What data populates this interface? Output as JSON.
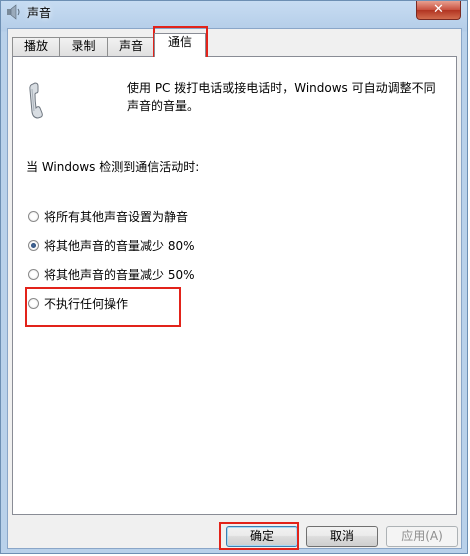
{
  "window": {
    "title": "声音",
    "close_label": "✕"
  },
  "tabs": [
    {
      "label": "播放",
      "active": false
    },
    {
      "label": "录制",
      "active": false
    },
    {
      "label": "声音",
      "active": false
    },
    {
      "label": "通信",
      "active": true
    }
  ],
  "panel": {
    "description": "使用 PC 拨打电话或接电话时，Windows 可自动调整不同声音的音量。",
    "section_label": "当 Windows 检测到通信活动时:",
    "options": [
      {
        "label": "将所有其他声音设置为静音",
        "checked": false
      },
      {
        "label": "将其他声音的音量减少 80%",
        "checked": true
      },
      {
        "label": "将其他声音的音量减少 50%",
        "checked": false
      },
      {
        "label": "不执行任何操作",
        "checked": false
      }
    ]
  },
  "buttons": {
    "ok": "确定",
    "cancel": "取消",
    "apply": "应用(A)"
  },
  "colors": {
    "highlight": "#e2231a"
  }
}
